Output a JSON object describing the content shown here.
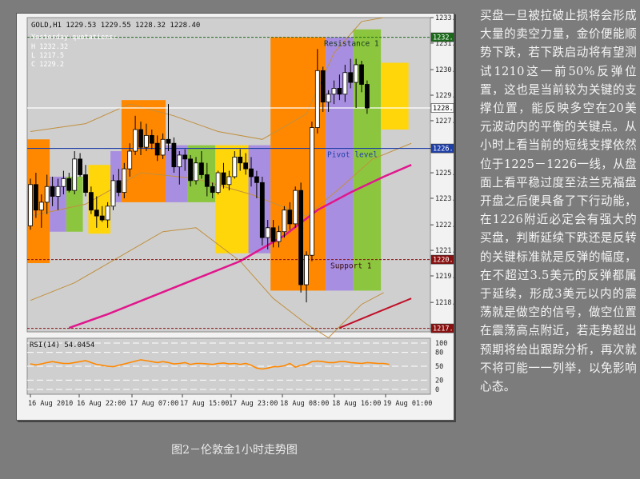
{
  "chart_data": {
    "type": "candlestick",
    "title": "GOLD,H1  1229.53 1229.55 1228.32 1228.40",
    "yesterday": {
      "heading": "Yesterday quotations:",
      "lines": [
        "H 1232.32",
        "L 1217.5",
        "C 1229.2"
      ]
    },
    "ylim": [
      1217.0,
      1233.0
    ],
    "y_ticks": [
      "1233.00",
      "1231.70",
      "1230.35",
      "1229.05",
      "1227.75",
      "1226.34",
      "1225.10",
      "1223.80",
      "1222.45",
      "1221.15",
      "1219.85",
      "1218.50",
      "1217.18"
    ],
    "x_ticks": [
      "16 Aug 2010",
      "16 Aug 22:00",
      "17 Aug 07:00",
      "17 Aug 15:00",
      "17 Aug 23:00",
      "18 Aug 08:00",
      "18 Aug 16:00",
      "19 Aug 01:00"
    ],
    "levels": [
      {
        "name": "Resistance 1",
        "value": 1232.0,
        "label": "1232.00",
        "color": "#1a6a1a",
        "style": "dashed"
      },
      {
        "name": "Pivot level",
        "value": 1226.34,
        "label": "1226.34",
        "color": "#1f3fa8",
        "style": "solid"
      },
      {
        "name": "Support 1",
        "value": 1220.68,
        "label": "1220.68",
        "color": "#8a1010",
        "style": "dashed"
      },
      {
        "name": "",
        "value": 1217.18,
        "label": "1217.18",
        "color": "#8a1010",
        "style": "dashed"
      },
      {
        "name": "",
        "value": 1228.4,
        "label": "1228.40",
        "color": "#ffffff",
        "style": "solid"
      }
    ],
    "level_text": {
      "resistance": "Resistance 1",
      "pivot": "Pivot level",
      "support": "Support 1"
    },
    "colors": {
      "orange": "#ff8800",
      "purple": "#a88ee0",
      "green": "#8cc63e",
      "yellow": "#ffd60a",
      "ma_pink": "#e0178c",
      "ma_red": "#c01028",
      "band": "#c09040"
    },
    "candles": [
      [
        1222.4,
        1224.8,
        1222.2,
        1224.5
      ],
      [
        1224.5,
        1225.1,
        1222.8,
        1223.2
      ],
      [
        1223.2,
        1224.0,
        1222.3,
        1223.6
      ],
      [
        1223.6,
        1225.0,
        1223.0,
        1224.4
      ],
      [
        1224.4,
        1224.9,
        1223.4,
        1223.9
      ],
      [
        1223.9,
        1224.8,
        1223.2,
        1224.4
      ],
      [
        1224.4,
        1225.2,
        1224.0,
        1224.8
      ],
      [
        1224.8,
        1225.1,
        1224.1,
        1224.2
      ],
      [
        1224.2,
        1226.2,
        1224.0,
        1225.8
      ],
      [
        1225.8,
        1226.1,
        1224.9,
        1225.0
      ],
      [
        1225.0,
        1225.5,
        1223.9,
        1224.1
      ],
      [
        1224.1,
        1224.4,
        1223.0,
        1223.2
      ],
      [
        1223.2,
        1223.9,
        1222.3,
        1222.9
      ],
      [
        1222.9,
        1223.4,
        1222.6,
        1222.7
      ],
      [
        1222.7,
        1223.6,
        1222.3,
        1223.4
      ],
      [
        1223.4,
        1225.0,
        1223.2,
        1224.7
      ],
      [
        1224.7,
        1225.3,
        1223.9,
        1224.1
      ],
      [
        1224.1,
        1225.6,
        1223.8,
        1225.3
      ],
      [
        1225.3,
        1226.6,
        1224.9,
        1226.2
      ],
      [
        1226.2,
        1228.0,
        1226.0,
        1227.3
      ],
      [
        1227.3,
        1227.7,
        1226.0,
        1226.4
      ],
      [
        1226.4,
        1227.6,
        1226.2,
        1227.0
      ],
      [
        1227.0,
        1227.3,
        1226.3,
        1226.6
      ],
      [
        1226.6,
        1227.0,
        1225.7,
        1226.0
      ],
      [
        1226.0,
        1227.1,
        1225.8,
        1226.8
      ],
      [
        1226.8,
        1228.6,
        1226.2,
        1226.6
      ],
      [
        1226.6,
        1226.9,
        1225.1,
        1225.4
      ],
      [
        1225.4,
        1226.2,
        1224.5,
        1226.0
      ],
      [
        1226.0,
        1226.3,
        1225.2,
        1225.8
      ],
      [
        1225.8,
        1226.0,
        1224.4,
        1224.7
      ],
      [
        1224.7,
        1225.9,
        1224.5,
        1225.6
      ],
      [
        1225.6,
        1226.2,
        1224.8,
        1225.0
      ],
      [
        1225.0,
        1225.6,
        1223.9,
        1224.4
      ],
      [
        1224.4,
        1224.6,
        1223.8,
        1224.1
      ],
      [
        1224.1,
        1225.2,
        1224.0,
        1225.1
      ],
      [
        1225.1,
        1225.6,
        1224.3,
        1224.5
      ],
      [
        1224.5,
        1225.2,
        1224.2,
        1224.9
      ],
      [
        1224.9,
        1226.2,
        1224.8,
        1225.9
      ],
      [
        1225.9,
        1226.3,
        1225.2,
        1225.6
      ],
      [
        1225.6,
        1226.1,
        1225.0,
        1225.3
      ],
      [
        1225.3,
        1225.9,
        1224.4,
        1224.9
      ],
      [
        1224.9,
        1225.2,
        1223.8,
        1224.6
      ],
      [
        1224.6,
        1224.9,
        1221.4,
        1221.8
      ],
      [
        1221.8,
        1222.7,
        1221.2,
        1222.3
      ],
      [
        1222.3,
        1222.7,
        1221.3,
        1221.6
      ],
      [
        1221.6,
        1222.4,
        1221.3,
        1222.1
      ],
      [
        1222.1,
        1223.4,
        1221.8,
        1223.2
      ],
      [
        1223.2,
        1223.6,
        1222.2,
        1222.5
      ],
      [
        1222.5,
        1224.4,
        1222.3,
        1224.2
      ],
      [
        1224.2,
        1224.6,
        1219.0,
        1219.4
      ],
      [
        1219.4,
        1221.1,
        1218.5,
        1220.9
      ],
      [
        1220.9,
        1227.7,
        1220.6,
        1227.4
      ],
      [
        1227.4,
        1231.4,
        1227.1,
        1230.3
      ],
      [
        1230.3,
        1230.5,
        1228.2,
        1228.7
      ],
      [
        1228.7,
        1229.3,
        1228.2,
        1229.1
      ],
      [
        1229.1,
        1229.8,
        1228.6,
        1229.4
      ],
      [
        1229.4,
        1230.1,
        1228.8,
        1229.1
      ],
      [
        1229.1,
        1230.6,
        1228.7,
        1230.2
      ],
      [
        1230.2,
        1230.9,
        1229.4,
        1229.7
      ],
      [
        1229.7,
        1230.9,
        1228.4,
        1230.6
      ],
      [
        1230.6,
        1230.8,
        1229.2,
        1229.6
      ],
      [
        1229.6,
        1229.8,
        1228.1,
        1228.4
      ]
    ],
    "boxes": [
      [
        0,
        4,
        1220.5,
        1226.8,
        "orange"
      ],
      [
        4,
        7,
        1222.1,
        1224.9,
        "purple"
      ],
      [
        7,
        10,
        1222.1,
        1224.9,
        "green"
      ],
      [
        11,
        15,
        1222.0,
        1225.5,
        "yellow"
      ],
      [
        15,
        17,
        1223.6,
        1226.2,
        "purple"
      ],
      [
        17,
        25,
        1223.6,
        1228.8,
        "orange"
      ],
      [
        25,
        29,
        1223.6,
        1226.5,
        "purple"
      ],
      [
        29,
        34,
        1223.6,
        1226.5,
        "green"
      ],
      [
        34,
        40,
        1221.0,
        1226.5,
        "yellow"
      ],
      [
        40,
        44,
        1221.0,
        1226.5,
        "purple"
      ],
      [
        44,
        54,
        1219.1,
        1232.0,
        "orange"
      ],
      [
        54,
        59,
        1219.1,
        1232.0,
        "purple"
      ],
      [
        59,
        64,
        1219.1,
        1232.4,
        "green"
      ],
      [
        64,
        69,
        1227.3,
        1230.7,
        "yellow"
      ]
    ],
    "ma_pink": [
      [
        7,
        1217.2
      ],
      [
        14,
        1217.9
      ],
      [
        22,
        1218.8
      ],
      [
        30,
        1219.7
      ],
      [
        38,
        1220.6
      ],
      [
        46,
        1221.9
      ],
      [
        52,
        1223.2
      ],
      [
        58,
        1224.1
      ],
      [
        64,
        1224.9
      ],
      [
        69,
        1225.5
      ]
    ],
    "ma_red": [
      [
        56,
        1217.2
      ],
      [
        62,
        1217.9
      ],
      [
        69,
        1218.7
      ]
    ],
    "band_upper": [
      [
        0,
        1227.2
      ],
      [
        10,
        1227.6
      ],
      [
        18,
        1228.6
      ],
      [
        26,
        1228.0
      ],
      [
        34,
        1227.2
      ],
      [
        42,
        1226.8
      ],
      [
        50,
        1228.1
      ],
      [
        55,
        1231.2
      ],
      [
        60,
        1232.8
      ],
      [
        64,
        1233.0
      ]
    ],
    "band_lower": [
      [
        0,
        1218.6
      ],
      [
        8,
        1219.5
      ],
      [
        16,
        1220.8
      ],
      [
        24,
        1222.1
      ],
      [
        30,
        1222.3
      ],
      [
        38,
        1220.6
      ],
      [
        44,
        1218.7
      ],
      [
        50,
        1217.4
      ],
      [
        54,
        1216.7
      ],
      [
        60,
        1218.4
      ],
      [
        64,
        1219.0
      ]
    ],
    "band_mid": [
      [
        0,
        1222.9
      ],
      [
        10,
        1223.5
      ],
      [
        20,
        1225.1
      ],
      [
        30,
        1224.8
      ],
      [
        40,
        1224.0
      ],
      [
        50,
        1222.9
      ],
      [
        56,
        1224.3
      ],
      [
        62,
        1225.8
      ],
      [
        69,
        1226.6
      ]
    ],
    "rsi": {
      "label": "RSI(14) 54.0454",
      "ticks": [
        "100",
        "80",
        "50",
        "20",
        "0"
      ],
      "levels": [
        100,
        80,
        50,
        20,
        0
      ],
      "values": [
        55,
        53,
        55,
        58,
        60,
        58,
        56,
        56,
        58,
        60,
        62,
        58,
        54,
        52,
        50,
        49,
        52,
        55,
        58,
        61,
        64,
        62,
        60,
        58,
        60,
        58,
        55,
        56,
        58,
        54,
        56,
        56,
        55,
        54,
        56,
        57,
        55,
        56,
        54,
        56,
        52,
        46,
        44,
        46,
        49,
        49,
        51,
        56,
        48,
        52,
        54,
        60,
        61,
        60,
        58,
        58,
        60,
        60,
        58,
        57,
        56,
        58,
        57,
        56,
        56,
        54
      ]
    }
  },
  "caption": "图2－伦敦金1小时走势图",
  "article": "买盘一旦被拉破止损将会形成大量的卖空力量，金价便能顺势下跌，若下跌启动将有望测试1210这一前50%反弹位置，这也是当前较为关键的支撑位置，能反映多空在20美元波动内的平衡的关键点。从小时上看当前的短线支撑依然位于1225－1226一线，从盘面上看平稳过度至法兰克福盘开盘之后便具备了下行动能，在1226附近必定会有强大的买盘，判断延续下跌还是反转的关键标准就是反弹的幅度，在不超过3.5美元的反弹都属于延续，形成3美元以内的震荡就是做空的信号，做空位置在震荡高点附近，若走势超出预期将给出跟踪分析，再次就不将可能一一列举，以免影响心态。"
}
